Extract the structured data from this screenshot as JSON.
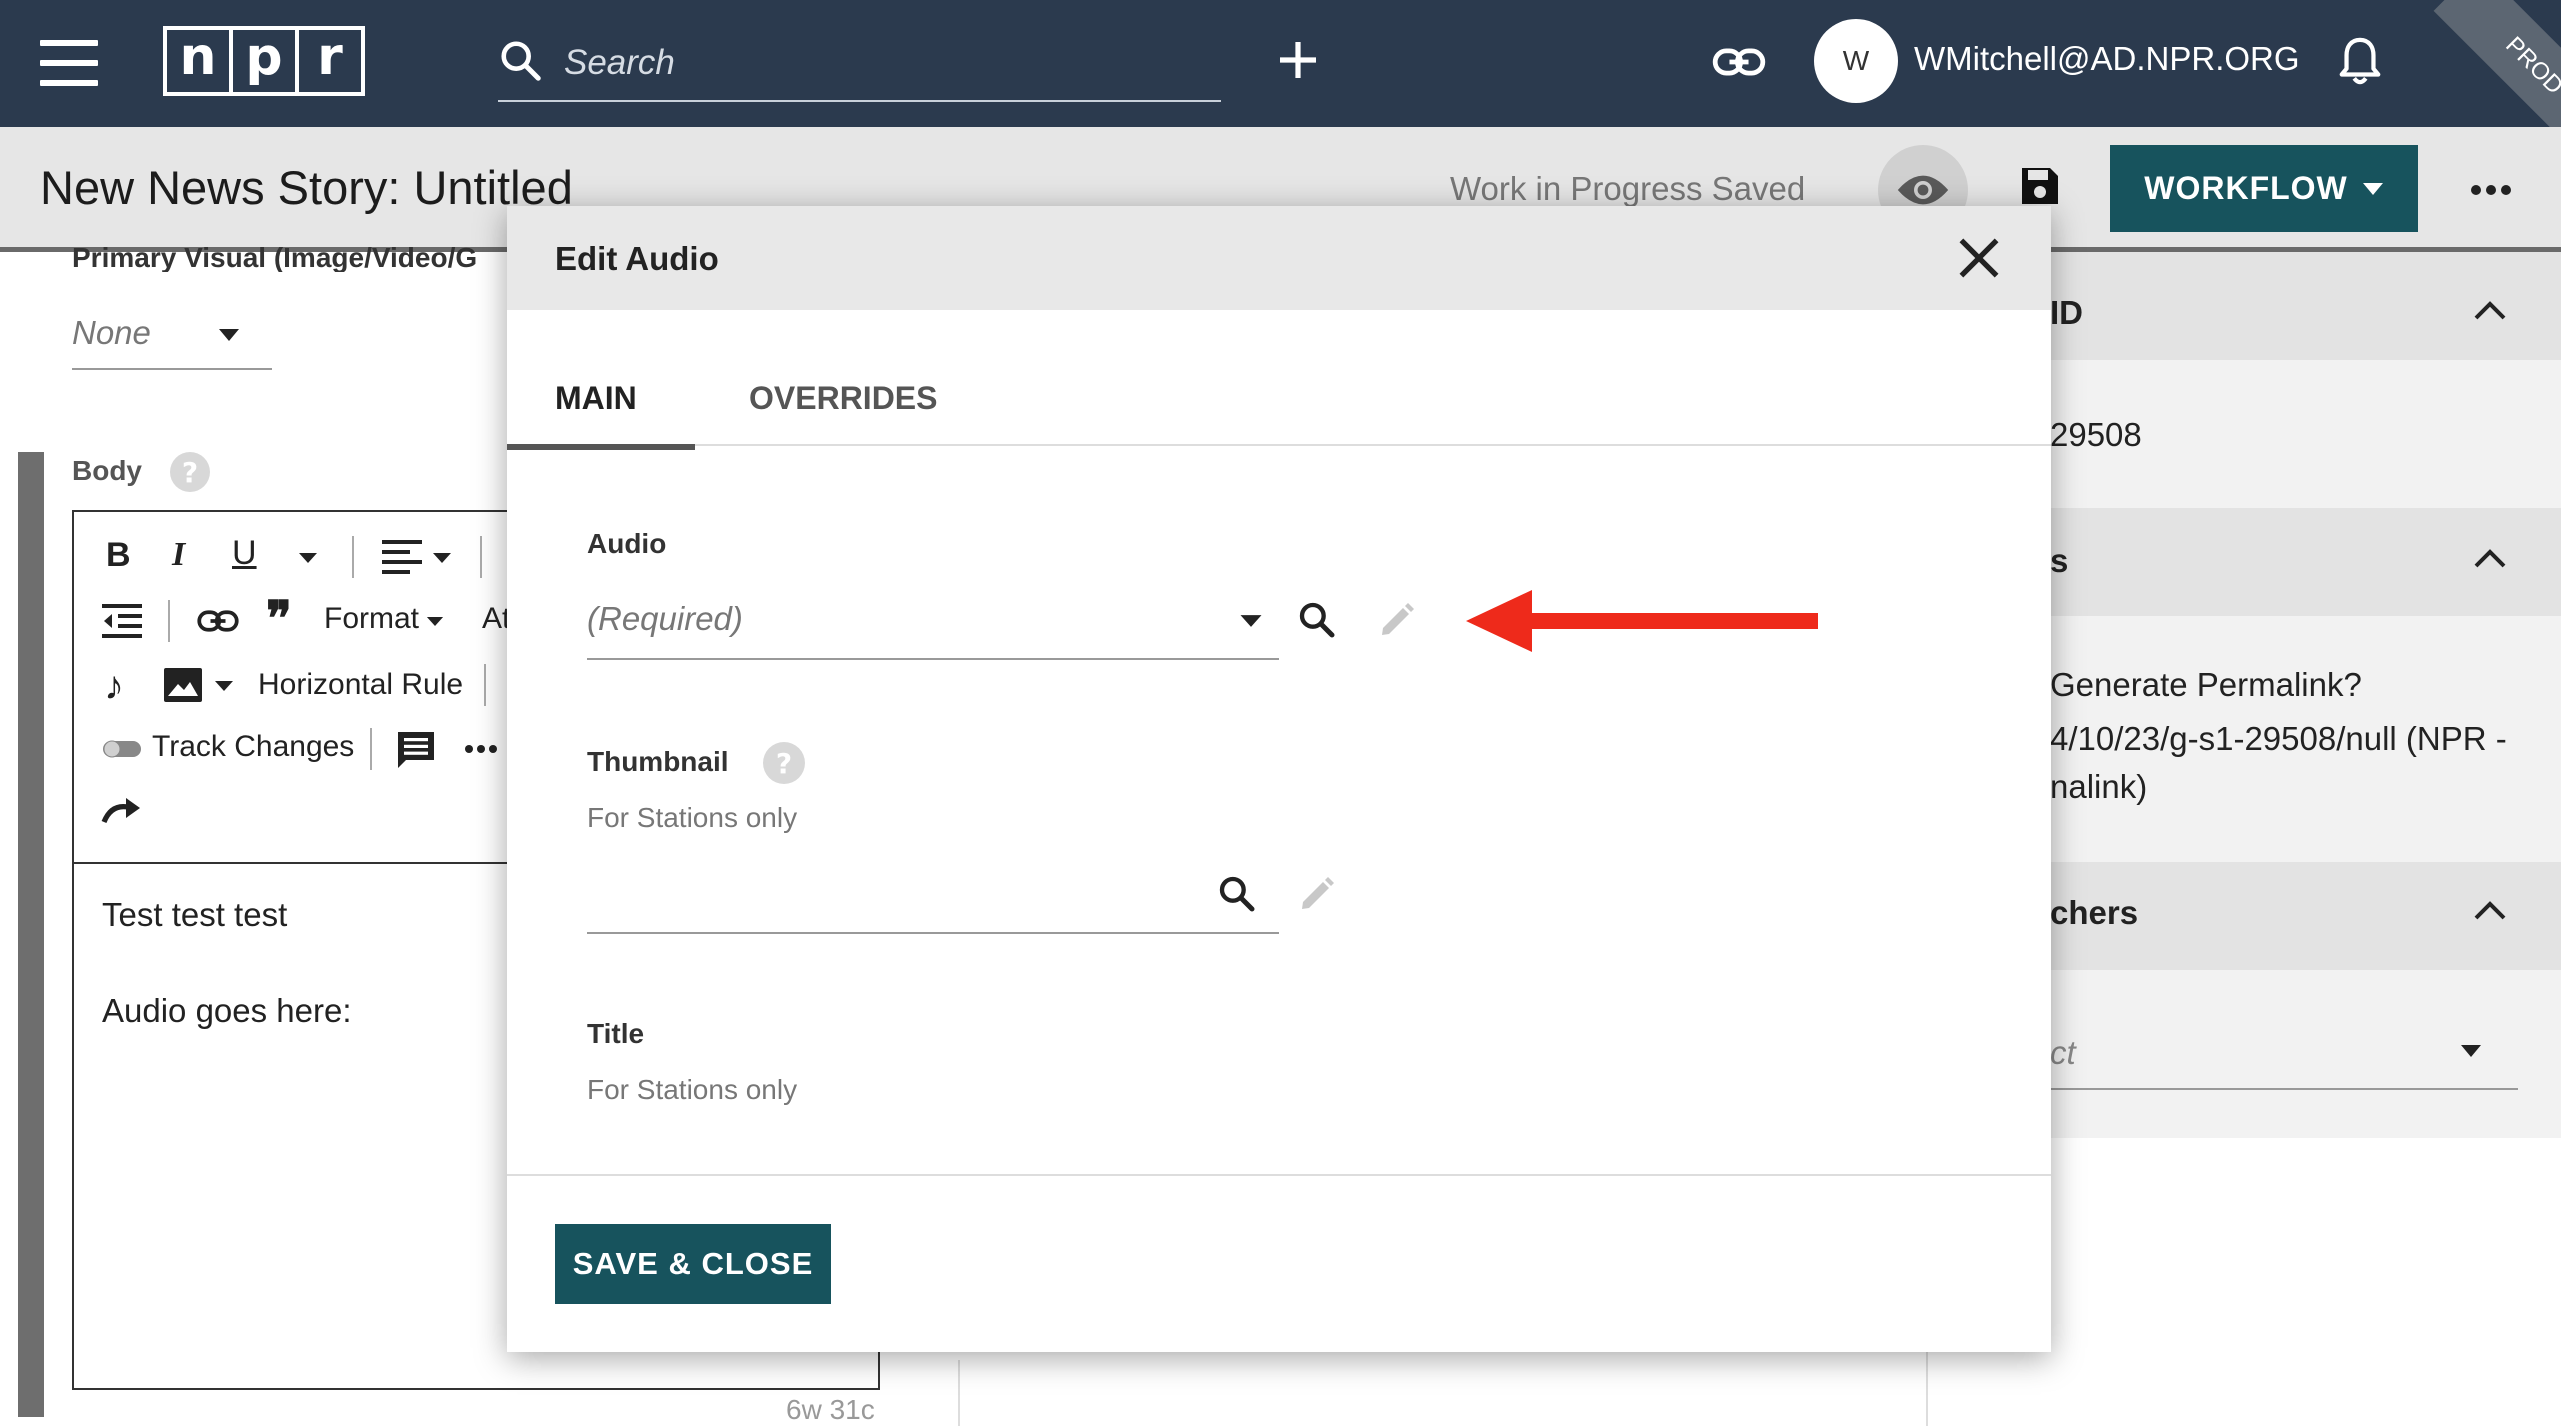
{
  "topbar": {
    "logo_letters": [
      "n",
      "p",
      "r"
    ],
    "search_placeholder": "Search",
    "user_initial": "W",
    "user_email": "WMitchell@AD.NPR.ORG",
    "environment": "PROD",
    "background_color": "#2b3a4e"
  },
  "header": {
    "story_title": "New News Story: Untitled",
    "save_status": "Work in Progress Saved",
    "workflow_label": "WORKFLOW",
    "accent_color": "#17535d"
  },
  "editor": {
    "primary_visual_label": "Primary Visual (Image/Video/G",
    "primary_visual_value": "None",
    "body_label": "Body",
    "help_glyph": "?",
    "toolbar": {
      "format_label": "Format",
      "at_label": "At",
      "horizontal_rule_label": "Horizontal Rule",
      "track_changes_label": "Track Changes"
    },
    "body_lines": [
      "Test test test",
      "Audio goes here:"
    ],
    "word_count": "6w 31c"
  },
  "right_panel": {
    "section1_title": "ID",
    "section1_value": "29508",
    "section2_title": "s",
    "permalink_question": "Generate Permalink?",
    "permalink_line1": "4/10/23/g-s1-29508/null (NPR -",
    "permalink_line2": "nalink)",
    "section3_title": "chers",
    "section3_placeholder": "ct"
  },
  "dialog": {
    "title": "Edit Audio",
    "tabs": [
      {
        "label": "MAIN",
        "active": true
      },
      {
        "label": "OVERRIDES",
        "active": false
      }
    ],
    "audio_label": "Audio",
    "audio_placeholder": "(Required)",
    "thumbnail_label": "Thumbnail",
    "thumbnail_help": "?",
    "thumbnail_note": "For Stations only",
    "title_label": "Title",
    "title_note": "For Stations only",
    "save_button": "SAVE & CLOSE",
    "annotation_arrow_color": "#ee2a1b"
  }
}
